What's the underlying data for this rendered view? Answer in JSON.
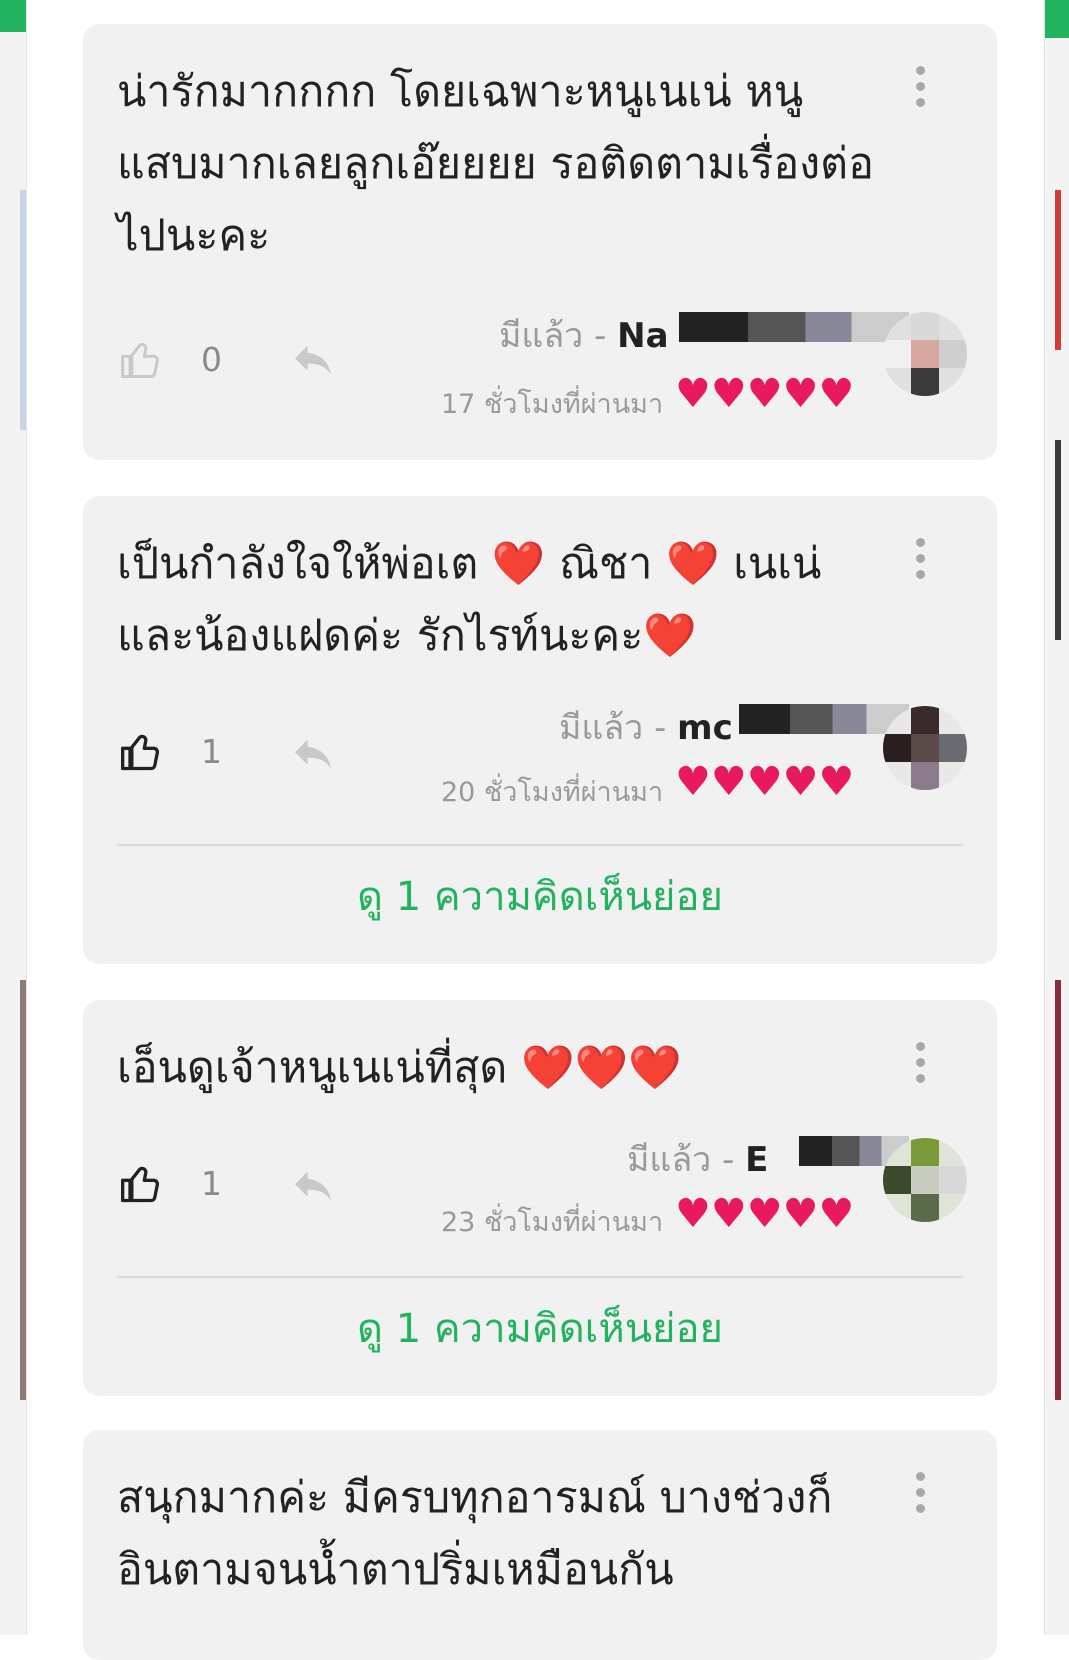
{
  "colors": {
    "accent_green": "#22b35e",
    "heart_pink": "#e8195f",
    "card_bg": "#f1f1f1"
  },
  "status_prefix": "มีแล้ว -",
  "comments": [
    {
      "text": "น่ารักมากกกก โดยเฉพาะหนูเนเน่ หนูแสบมากเลยลูกเอ๊ยยยย รอติดตามเรื่องต่อไปนะคะ",
      "likes": "0",
      "liked": false,
      "username": "Na",
      "time": "17 ชั่วโมงที่ผ่านมา",
      "hearts": 5
    },
    {
      "text": "เป็นกำลังใจให้พ่อเต ❤️ ณิชา ❤️ เนเน่ และน้องแฝดค่ะ  รักไรท์นะคะ❤️",
      "likes": "1",
      "liked": true,
      "username": "mc",
      "time": "20 ชั่วโมงที่ผ่านมา",
      "hearts": 5,
      "view_replies": "ดู 1 ความคิดเห็นย่อย"
    },
    {
      "text": "เอ็นดูเจ้าหนูเนเน่ที่สุด ❤️❤️❤️",
      "likes": "1",
      "liked": true,
      "username": "E",
      "time": "23 ชั่วโมงที่ผ่านมา",
      "hearts": 5,
      "view_replies": "ดู 1 ความคิดเห็นย่อย"
    },
    {
      "text": "สนุกมากค่ะ มีครบทุกอารมณ์ บางช่วงก็อินตามจนน้ำตาปริ่มเหมือนกัน"
    }
  ]
}
